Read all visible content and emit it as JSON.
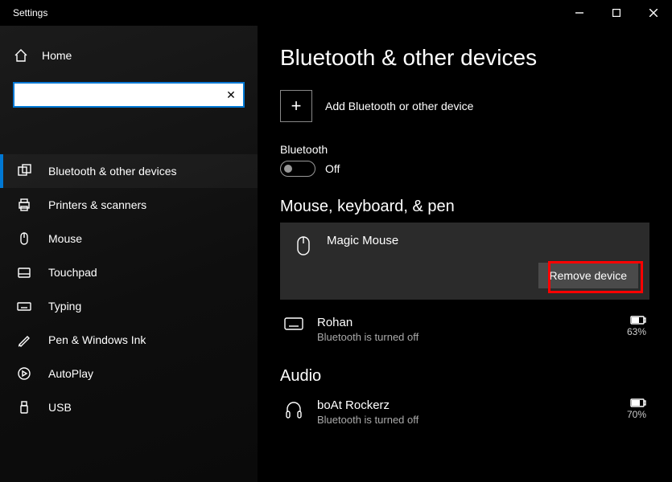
{
  "window": {
    "title": "Settings"
  },
  "sidebar": {
    "home": "Home",
    "search_placeholder": "",
    "items": [
      {
        "label": "Bluetooth & other devices",
        "selected": true
      },
      {
        "label": "Printers & scanners"
      },
      {
        "label": "Mouse"
      },
      {
        "label": "Touchpad"
      },
      {
        "label": "Typing"
      },
      {
        "label": "Pen & Windows Ink"
      },
      {
        "label": "AutoPlay"
      },
      {
        "label": "USB"
      }
    ]
  },
  "main": {
    "title": "Bluetooth & other devices",
    "add_label": "Add Bluetooth or other device",
    "bt_label": "Bluetooth",
    "bt_state": "Off",
    "sections": {
      "mouse_kb": {
        "heading": "Mouse, keyboard, & pen",
        "devices": [
          {
            "name": "Magic Mouse",
            "selected": true,
            "remove": "Remove device"
          },
          {
            "name": "Rohan",
            "status": "Bluetooth is turned off",
            "battery": "63%"
          }
        ]
      },
      "audio": {
        "heading": "Audio",
        "devices": [
          {
            "name": "boAt Rockerz",
            "status": "Bluetooth is turned off",
            "battery": "70%"
          }
        ]
      }
    }
  }
}
